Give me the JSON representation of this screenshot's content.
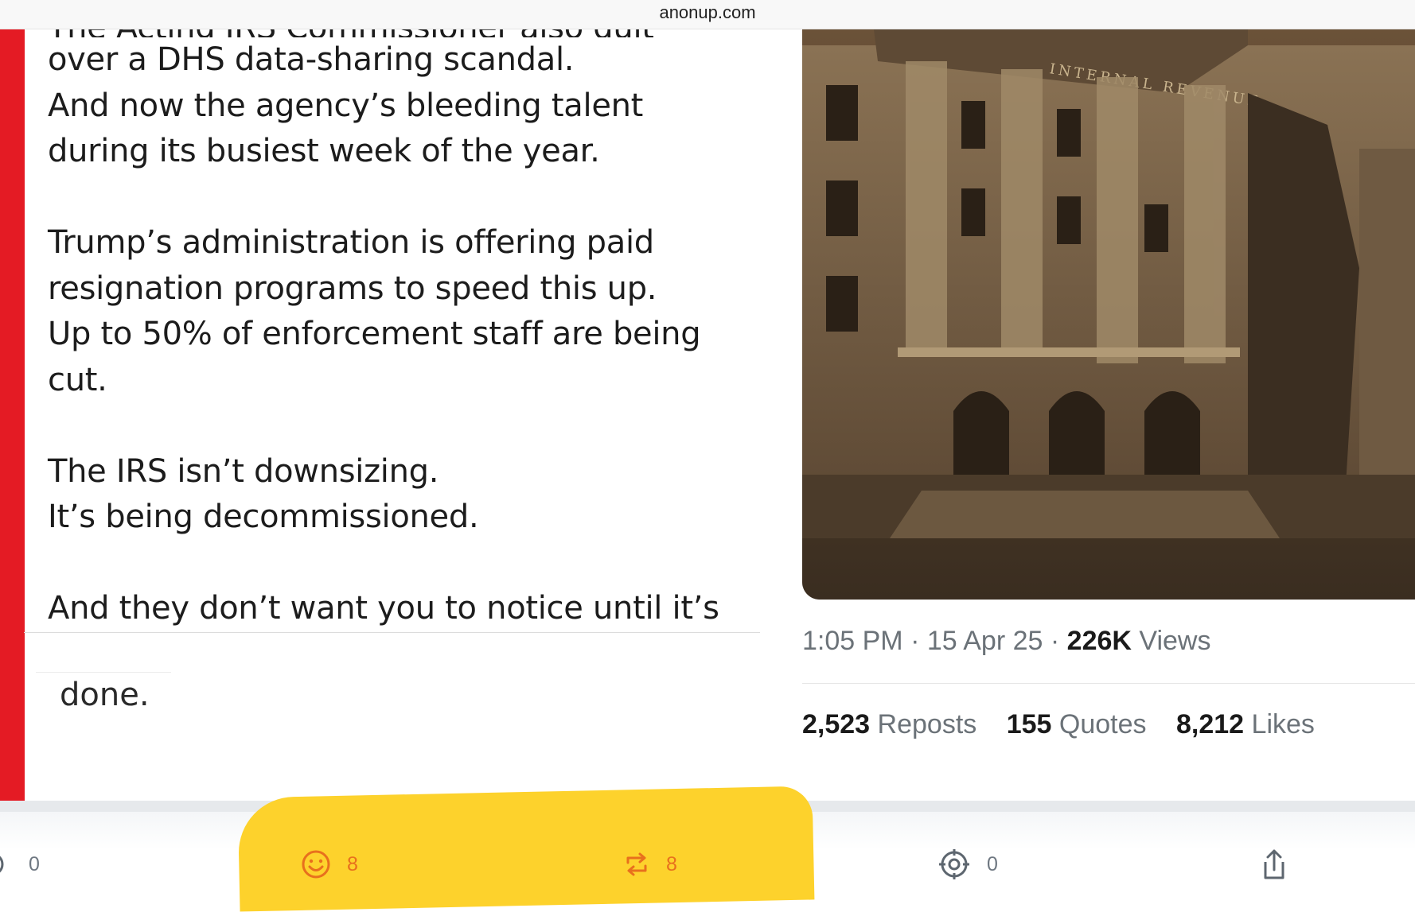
{
  "browser": {
    "domain": "anonup.com"
  },
  "post": {
    "partial_first_line": "The Acting IRS Commissioner also quit",
    "lines": [
      "over a DHS data-sharing scandal.",
      "And now the agency’s bleeding talent",
      "during its busiest week of the year.",
      "",
      "Trump’s administration is offering paid",
      "resignation programs to speed this up.",
      "Up to 50% of enforcement staff are being",
      "cut.",
      "",
      "The IRS isn’t downsizing.",
      "It’s being decommissioned.",
      "",
      "And they don’t want you to notice until it’s"
    ],
    "continuation": "done."
  },
  "embed": {
    "image_inscription": "INTERNAL REVENUE",
    "time": "1:05 PM",
    "date": "15 Apr 25",
    "views_count": "226K",
    "views_label": "Views",
    "separator": "·",
    "reposts_count": "2,523",
    "reposts_label": "Reposts",
    "quotes_count": "155",
    "quotes_label": "Quotes",
    "likes_count": "8,212",
    "likes_label": "Likes"
  },
  "actions": {
    "comments": {
      "icon": "comment-icon",
      "count": "0"
    },
    "reactions": {
      "icon": "smiley-icon",
      "count": "8"
    },
    "reposts": {
      "icon": "repost-icon",
      "count": "8"
    },
    "target": {
      "icon": "target-icon",
      "count": "0"
    },
    "share": {
      "icon": "share-icon"
    }
  },
  "colors": {
    "accent_red": "#e41b24",
    "highlight_yellow": "#fdd22c",
    "active_orange": "#e8701d",
    "muted_gray": "#6e7781"
  }
}
